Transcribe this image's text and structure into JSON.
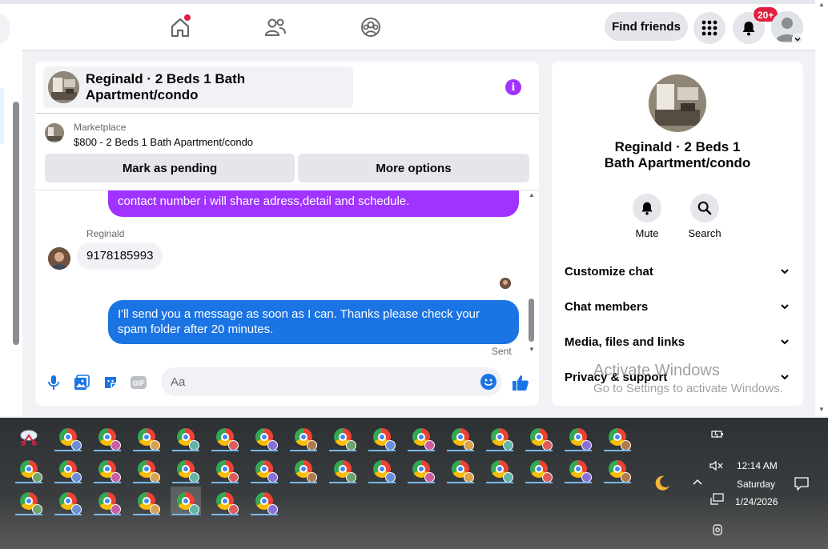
{
  "nav": {
    "notification_count": "20+",
    "find_friends_label": "Find friends"
  },
  "chat": {
    "title": "Reginald · 2 Beds 1 Bath Apartment/condo",
    "marketplace_label": "Marketplace",
    "listing_line": "$800 - 2 Beds 1 Bath Apartment/condo",
    "mark_pending_label": "Mark as pending",
    "more_options_label": "More options",
    "messages": {
      "outgoing_1_tail": "contact number i will share adress,detail and schedule.",
      "sender_name": "Reginald",
      "incoming_1": "9178185993",
      "outgoing_2": "I'll send you a message as soon as I can. Thanks please check your spam folder after 20 minutes.",
      "status": "Sent"
    },
    "composer_placeholder": "Aa"
  },
  "info": {
    "name": "Reginald · 2 Beds 1 Bath Apartment/condo",
    "mute_label": "Mute",
    "search_label": "Search",
    "rows": [
      "Customize chat",
      "Chat members",
      "Media, files and links",
      "Privacy & support"
    ]
  },
  "watermark": {
    "line1": "Activate Windows",
    "line2": "Go to Settings to activate Windows."
  },
  "taskbar": {
    "time": "12:14 AM",
    "day": "Saturday",
    "date": "1/24/2026"
  },
  "colors": {
    "brand_blue": "#1b74e4",
    "purple_bubble": "#a033ff",
    "badge_red": "#e41e3f"
  }
}
